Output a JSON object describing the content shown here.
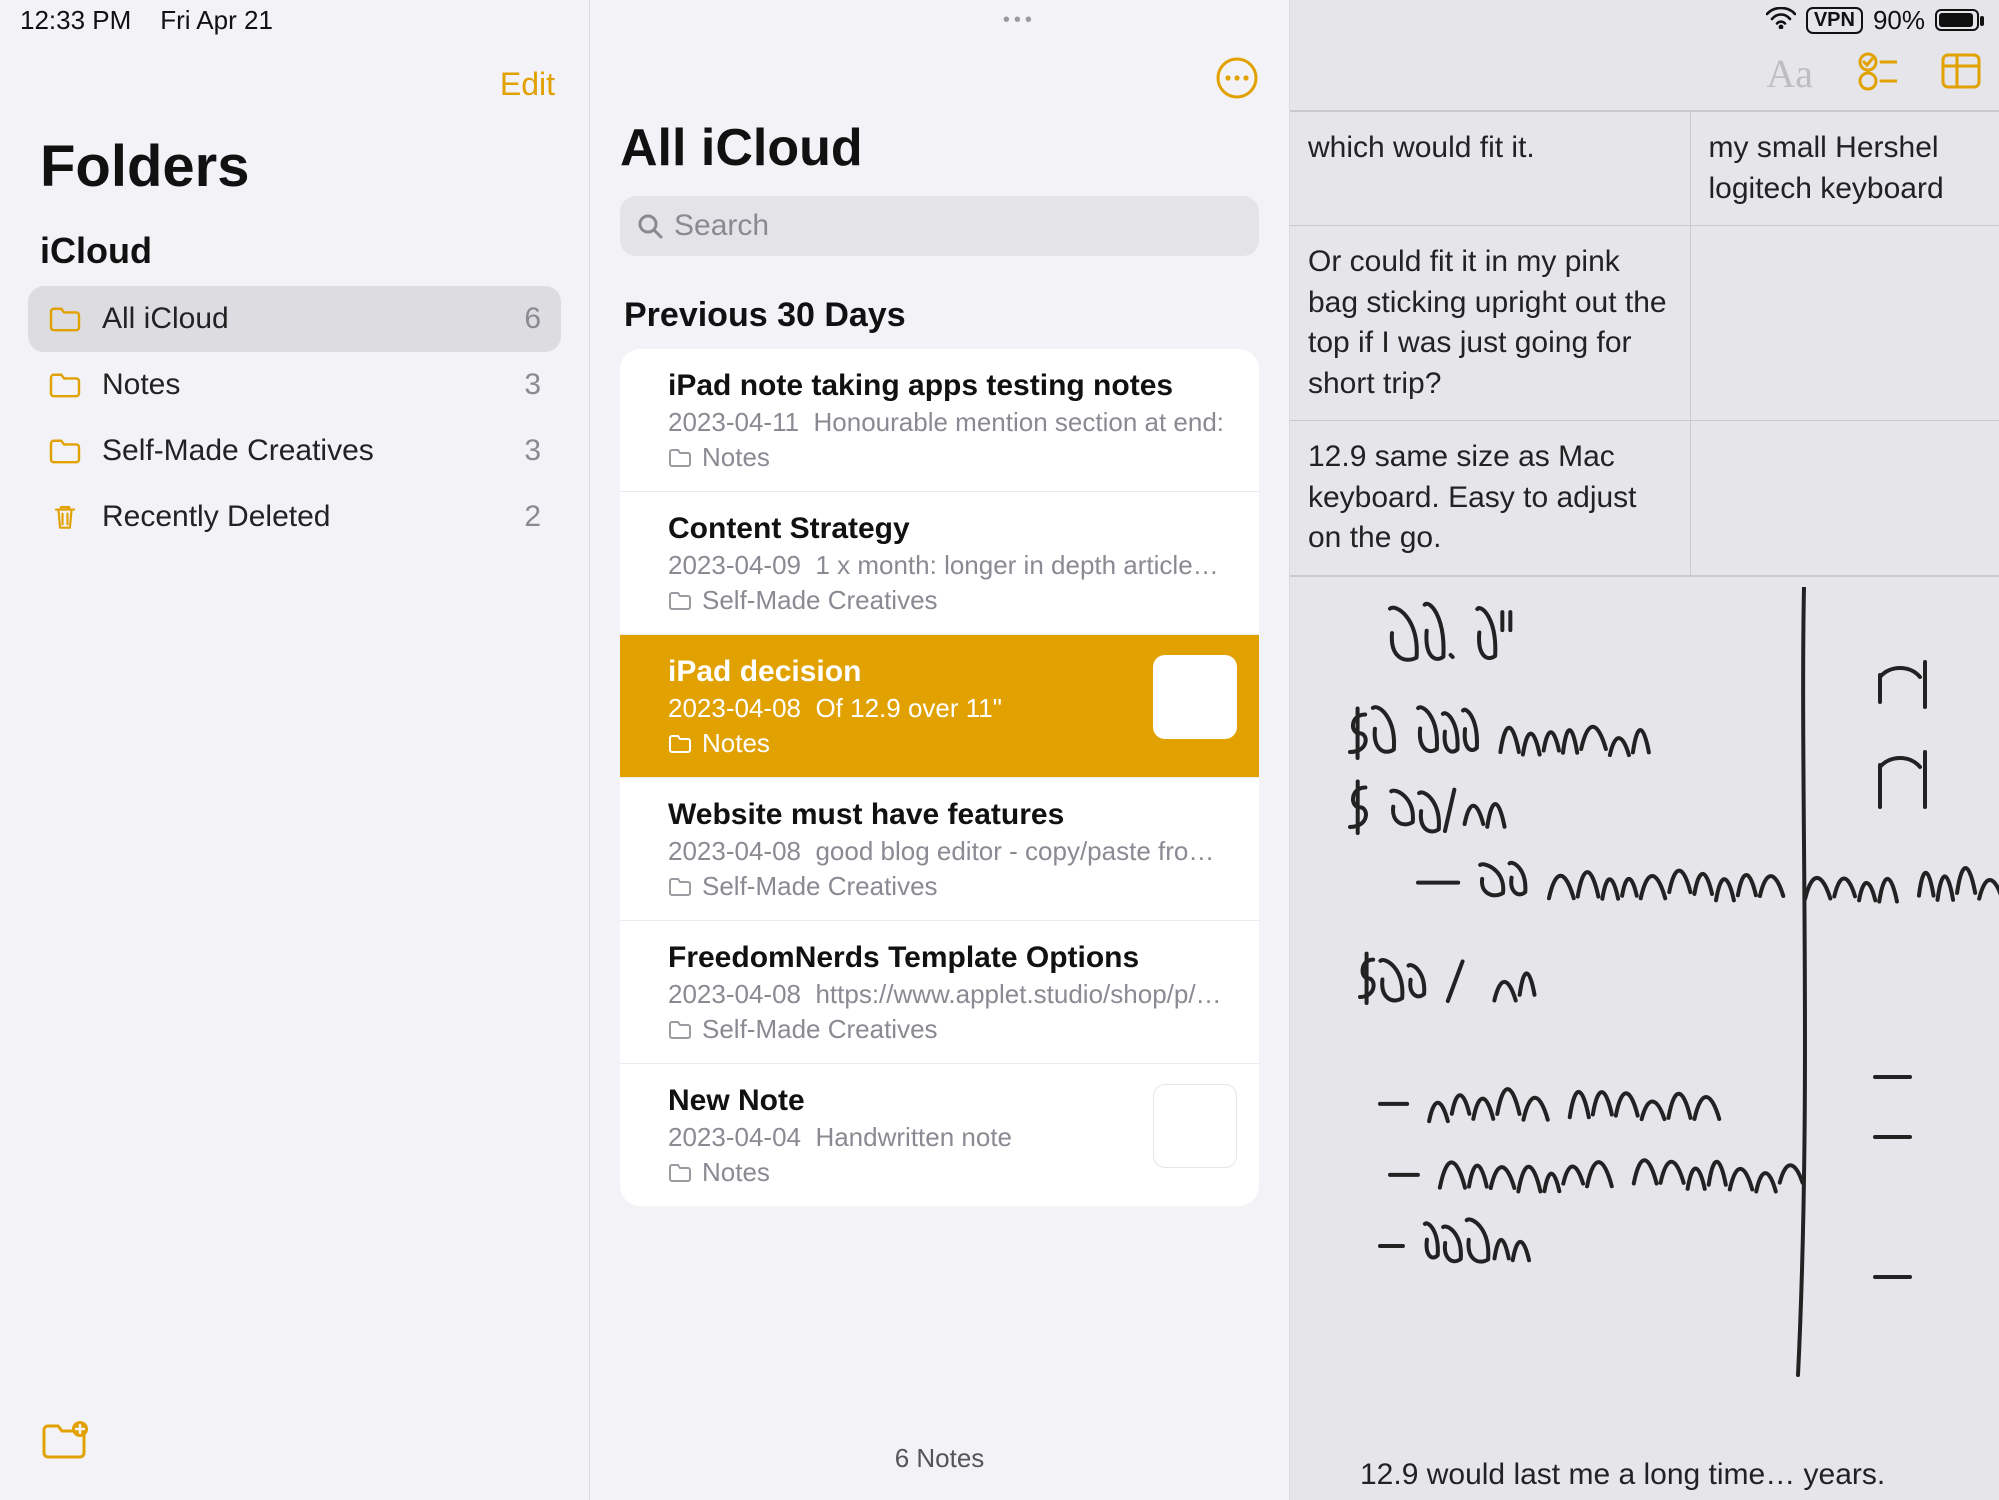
{
  "status": {
    "time": "12:33 PM",
    "date": "Fri Apr 21",
    "vpn": "VPN",
    "battery_pct": "90%"
  },
  "sidebar": {
    "edit": "Edit",
    "title": "Folders",
    "account": "iCloud",
    "folders": [
      {
        "name": "All iCloud",
        "count": "6",
        "selected": true,
        "icon": "folder"
      },
      {
        "name": "Notes",
        "count": "3",
        "selected": false,
        "icon": "folder"
      },
      {
        "name": "Self-Made Creatives",
        "count": "3",
        "selected": false,
        "icon": "folder"
      },
      {
        "name": "Recently Deleted",
        "count": "2",
        "selected": false,
        "icon": "trash"
      }
    ]
  },
  "noteslist": {
    "title": "All iCloud",
    "search_placeholder": "Search",
    "section": "Previous 30 Days",
    "notes": [
      {
        "title": "iPad note taking apps testing notes",
        "date": "2023-04-11",
        "snippet": "Honourable mention section at end:",
        "folder": "Notes",
        "selected": false,
        "thumb": false
      },
      {
        "title": "Content Strategy",
        "date": "2023-04-09",
        "snippet": "1 x month: longer in depth article…",
        "folder": "Self-Made Creatives",
        "selected": false,
        "thumb": false
      },
      {
        "title": "iPad decision",
        "date": "2023-04-08",
        "snippet": "Of 12.9 over 11\"",
        "folder": "Notes",
        "selected": true,
        "thumb": true
      },
      {
        "title": "Website must have features",
        "date": "2023-04-08",
        "snippet": "good blog editor - copy/paste fro…",
        "folder": "Self-Made Creatives",
        "selected": false,
        "thumb": false
      },
      {
        "title": "FreedomNerds Template Options",
        "date": "2023-04-08",
        "snippet": "https://www.applet.studio/shop/p/…",
        "folder": "Self-Made Creatives",
        "selected": false,
        "thumb": false
      },
      {
        "title": "New Note",
        "date": "2023-04-04",
        "snippet": "Handwritten note",
        "folder": "Notes",
        "selected": false,
        "thumb": true
      }
    ],
    "footer": "6 Notes"
  },
  "editor": {
    "table": {
      "row1a": "which would fit it.",
      "row1b": "my small Hershel logitech keyboard",
      "row2a": "Or could fit it in my pink bag sticking upright out the top if I was just going for short trip?",
      "row2b": "",
      "row3a": "12.9 same size as Mac keyboard. Easy to adjust on the go.",
      "row3b": ""
    },
    "handwriting_lines": [
      "12.9\"",
      "$1 220 upfront",
      "$ 90/mo",
      " — 15 additional line savings?",
      "$75 / mo",
      "— comfy typing",
      "— drawing surface",
      "— 256mb"
    ],
    "bottom_text": "12.9 would last me a long time… years."
  },
  "colors": {
    "accent": "#e1a100"
  }
}
